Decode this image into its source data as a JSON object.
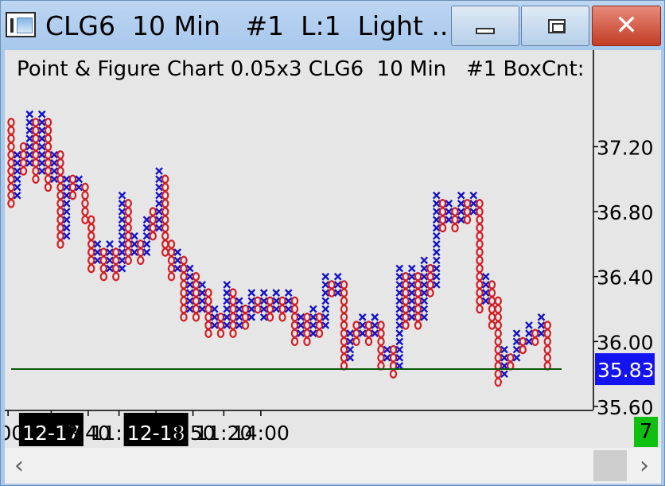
{
  "window": {
    "title": "CLG6  10 Min   #1  L:1  Light ...",
    "close_glyph": "✕"
  },
  "chart_header": "Point & Figure Chart 0.05x3 CLG6  10 Min   #1 BoxCnt:",
  "box_count": "7",
  "scrollbar": {
    "left_glyph": "‹",
    "right_glyph": "›"
  },
  "colors": {
    "up_x": "#1414c8",
    "down_o": "#d21e23",
    "price_line": "#0a5a0a",
    "last_price_bg": "#1414f0",
    "date_label_bg": "#000000"
  },
  "chart_data": {
    "type": "point-and-figure",
    "box_size": 0.05,
    "reversal": 3,
    "ylim": [
      35.6,
      37.55
    ],
    "y_ticks": [
      "37.20",
      "36.80",
      "36.40",
      "36.00",
      "35.60"
    ],
    "y_tick_values": [
      37.2,
      36.8,
      36.4,
      36.0,
      35.6
    ],
    "last_price": "35.83",
    "last_price_value": 35.83,
    "x_labels": [
      {
        "text": ":00",
        "col": -0.5,
        "highlight": false
      },
      {
        "text": "12-17",
        "col": 6.5,
        "highlight": true
      },
      {
        "text": "8:40",
        "col": 12.5,
        "highlight": false
      },
      {
        "text": "11:30",
        "col": 17.5,
        "highlight": false
      },
      {
        "text": "12-18",
        "col": 23.5,
        "highlight": true
      },
      {
        "text": "8:50",
        "col": 29.5,
        "highlight": false
      },
      {
        "text": "11:20",
        "col": 34.5,
        "highlight": false
      },
      {
        "text": "14:00",
        "col": 40.5,
        "highlight": false
      }
    ],
    "columns": [
      {
        "type": "O",
        "from": 36.85,
        "to": 37.35
      },
      {
        "type": "X",
        "from": 36.9,
        "to": 37.15
      },
      {
        "type": "O",
        "from": 37.05,
        "to": 37.2
      },
      {
        "type": "X",
        "from": 37.1,
        "to": 37.4
      },
      {
        "type": "O",
        "from": 37.0,
        "to": 37.35
      },
      {
        "type": "X",
        "from": 37.05,
        "to": 37.4
      },
      {
        "type": "O",
        "from": 36.95,
        "to": 37.35
      },
      {
        "type": "X",
        "from": 37.0,
        "to": 37.15
      },
      {
        "type": "O",
        "from": 36.6,
        "to": 37.15
      },
      {
        "type": "X",
        "from": 36.65,
        "to": 37.0
      },
      {
        "type": "O",
        "from": 36.9,
        "to": 37.0
      },
      {
        "type": "X",
        "from": 36.95,
        "to": 37.0
      },
      {
        "type": "O",
        "from": 36.75,
        "to": 36.95
      },
      {
        "type": "O",
        "from": 36.45,
        "to": 36.75
      },
      {
        "type": "X",
        "from": 36.5,
        "to": 36.6
      },
      {
        "type": "O",
        "from": 36.4,
        "to": 36.55
      },
      {
        "type": "X",
        "from": 36.45,
        "to": 36.6
      },
      {
        "type": "O",
        "from": 36.4,
        "to": 36.55
      },
      {
        "type": "X",
        "from": 36.45,
        "to": 36.9
      },
      {
        "type": "O",
        "from": 36.5,
        "to": 36.85
      },
      {
        "type": "X",
        "from": 36.55,
        "to": 36.65
      },
      {
        "type": "O",
        "from": 36.5,
        "to": 36.6
      },
      {
        "type": "X",
        "from": 36.55,
        "to": 36.75
      },
      {
        "type": "O",
        "from": 36.65,
        "to": 36.8
      },
      {
        "type": "X",
        "from": 36.7,
        "to": 37.05
      },
      {
        "type": "O",
        "from": 36.55,
        "to": 37.0
      },
      {
        "type": "O",
        "from": 36.4,
        "to": 36.6
      },
      {
        "type": "X",
        "from": 36.45,
        "to": 36.55
      },
      {
        "type": "O",
        "from": 36.15,
        "to": 36.5
      },
      {
        "type": "X",
        "from": 36.2,
        "to": 36.45
      },
      {
        "type": "O",
        "from": 36.15,
        "to": 36.4
      },
      {
        "type": "X",
        "from": 36.2,
        "to": 36.35
      },
      {
        "type": "O",
        "from": 36.05,
        "to": 36.3
      },
      {
        "type": "X",
        "from": 36.1,
        "to": 36.2
      },
      {
        "type": "O",
        "from": 36.05,
        "to": 36.15
      },
      {
        "type": "X",
        "from": 36.1,
        "to": 36.35
      },
      {
        "type": "O",
        "from": 36.05,
        "to": 36.3
      },
      {
        "type": "X",
        "from": 36.1,
        "to": 36.25
      },
      {
        "type": "O",
        "from": 36.1,
        "to": 36.2
      },
      {
        "type": "X",
        "from": 36.15,
        "to": 36.3
      },
      {
        "type": "O",
        "from": 36.2,
        "to": 36.25
      }
    ],
    "columns_2": [
      {
        "type": "X",
        "from": 36.15,
        "to": 36.3
      },
      {
        "type": "O",
        "from": 36.15,
        "to": 36.25
      },
      {
        "type": "X",
        "from": 36.2,
        "to": 36.3
      },
      {
        "type": "O",
        "from": 36.15,
        "to": 36.25
      },
      {
        "type": "X",
        "from": 36.2,
        "to": 36.3
      },
      {
        "type": "O",
        "from": 36.0,
        "to": 36.25
      },
      {
        "type": "X",
        "from": 36.05,
        "to": 36.15
      },
      {
        "type": "O",
        "from": 36.0,
        "to": 36.15
      },
      {
        "type": "X",
        "from": 36.05,
        "to": 36.2
      },
      {
        "type": "O",
        "from": 36.05,
        "to": 36.15
      },
      {
        "type": "X",
        "from": 36.1,
        "to": 36.4
      },
      {
        "type": "O",
        "from": 36.3,
        "to": 36.35
      },
      {
        "type": "X",
        "from": 36.3,
        "to": 36.4
      },
      {
        "type": "O",
        "from": 35.85,
        "to": 36.35
      },
      {
        "type": "X",
        "from": 35.9,
        "to": 36.05
      },
      {
        "type": "O",
        "from": 36.0,
        "to": 36.1
      },
      {
        "type": "X",
        "from": 36.05,
        "to": 36.15
      },
      {
        "type": "O",
        "from": 36.0,
        "to": 36.1
      },
      {
        "type": "X",
        "from": 36.05,
        "to": 36.15
      },
      {
        "type": "O",
        "from": 35.85,
        "to": 36.1
      },
      {
        "type": "X",
        "from": 35.9,
        "to": 35.95
      },
      {
        "type": "O",
        "from": 35.8,
        "to": 35.95
      },
      {
        "type": "X",
        "from": 35.85,
        "to": 36.45
      },
      {
        "type": "O",
        "from": 36.1,
        "to": 36.4
      },
      {
        "type": "X",
        "from": 36.15,
        "to": 36.45
      },
      {
        "type": "O",
        "from": 36.1,
        "to": 36.4
      },
      {
        "type": "X",
        "from": 36.15,
        "to": 36.5
      },
      {
        "type": "O",
        "from": 36.3,
        "to": 36.45
      },
      {
        "type": "X",
        "from": 36.35,
        "to": 36.9
      },
      {
        "type": "O",
        "from": 36.7,
        "to": 36.85
      },
      {
        "type": "X",
        "from": 36.75,
        "to": 36.85
      },
      {
        "type": "O",
        "from": 36.7,
        "to": 36.8
      },
      {
        "type": "X",
        "from": 36.75,
        "to": 36.9
      },
      {
        "type": "O",
        "from": 36.75,
        "to": 36.85
      },
      {
        "type": "X",
        "from": 36.8,
        "to": 36.9
      },
      {
        "type": "O",
        "from": 36.2,
        "to": 36.85
      },
      {
        "type": "X",
        "from": 36.25,
        "to": 36.4
      },
      {
        "type": "O",
        "from": 36.1,
        "to": 36.35
      },
      {
        "type": "O",
        "from": 35.75,
        "to": 36.25
      },
      {
        "type": "X",
        "from": 35.8,
        "to": 35.95
      },
      {
        "type": "O",
        "from": 35.85,
        "to": 35.9
      },
      {
        "type": "X",
        "from": 35.9,
        "to": 36.05
      },
      {
        "type": "O",
        "from": 35.95,
        "to": 36.0
      },
      {
        "type": "X",
        "from": 36.0,
        "to": 36.1
      },
      {
        "type": "O",
        "from": 36.0,
        "to": 36.05
      },
      {
        "type": "X",
        "from": 36.05,
        "to": 36.15
      },
      {
        "type": "O",
        "from": 35.85,
        "to": 36.1
      }
    ]
  }
}
